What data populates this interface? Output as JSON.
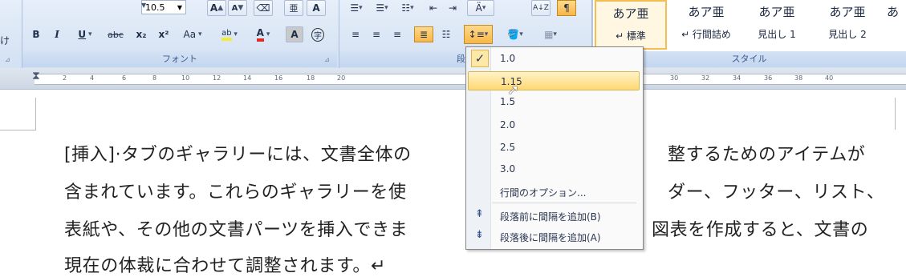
{
  "ribbon": {
    "left_partial_text": "け",
    "font_size": "10.5",
    "font_group_label": "フォント",
    "paragraph_group_label": "段落",
    "style_group_label": "スタイル",
    "bold": "B",
    "italic": "I",
    "underline": "U",
    "strike": "abc",
    "subscript": "x₂",
    "superscript": "x²",
    "change_case": "Aa",
    "grow_font": "A",
    "shrink_font": "A",
    "font_color": "A",
    "char_shading": "A",
    "enclose": "字",
    "highlight": "ab",
    "sort": "A↓Z"
  },
  "styles": [
    {
      "sample": "あア亜",
      "name": "↵ 標準"
    },
    {
      "sample": "あア亜",
      "name": "↵ 行間詰め"
    },
    {
      "sample": "あア亜",
      "name": "見出し 1"
    },
    {
      "sample": "あア亜",
      "name": "見出し 2"
    },
    {
      "sample": "あ",
      "name": ""
    }
  ],
  "ruler": {
    "ticks": [
      "2",
      "4",
      "6",
      "8",
      "10",
      "12",
      "14",
      "16",
      "18",
      "20",
      "30",
      "32",
      "34",
      "36",
      "38",
      "40"
    ]
  },
  "document": {
    "lines": [
      "[挿入]·タブのギャラリーには、文書全体の",
      "整するためのアイテムが",
      "含まれています。これらのギャラリーを使",
      "ダー、フッター、リスト、",
      "表紙や、その他の文書パーツを挿入できま",
      "図表を作成すると、文書の",
      "現在の体裁に合わせて調整されます。↵"
    ]
  },
  "line_spacing_menu": {
    "items": [
      "1.0",
      "1.15",
      "1.5",
      "2.0",
      "2.5",
      "3.0"
    ],
    "checked": "1.0",
    "highlighted": "1.15",
    "options": "行間のオプション...",
    "add_before": "段落前に間隔を追加(B)",
    "add_after": "段落後に間隔を追加(A)"
  }
}
